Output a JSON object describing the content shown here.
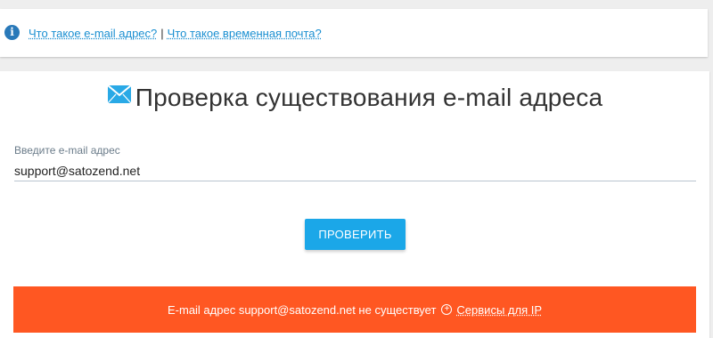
{
  "info_bar": {
    "link_email": "Что такое e-mail адрес?",
    "separator": "|",
    "link_temp": "Что такое временная почта?",
    "icon": "info-icon"
  },
  "main": {
    "title": "Проверка существования e-mail адреса",
    "title_icon": "envelope-check-icon",
    "field_label": "Введите e-mail адрес",
    "email_value": "support@satozend.net",
    "check_button": "ПРОВЕРИТЬ"
  },
  "result": {
    "message": "E-mail адрес support@satozend.net не существует",
    "link_icon": "plus-circle-icon",
    "link_text": "Сервисы для IP"
  },
  "colors": {
    "accent": "#1ba7e8",
    "error": "#ff5722",
    "link": "#1a8fd1"
  }
}
